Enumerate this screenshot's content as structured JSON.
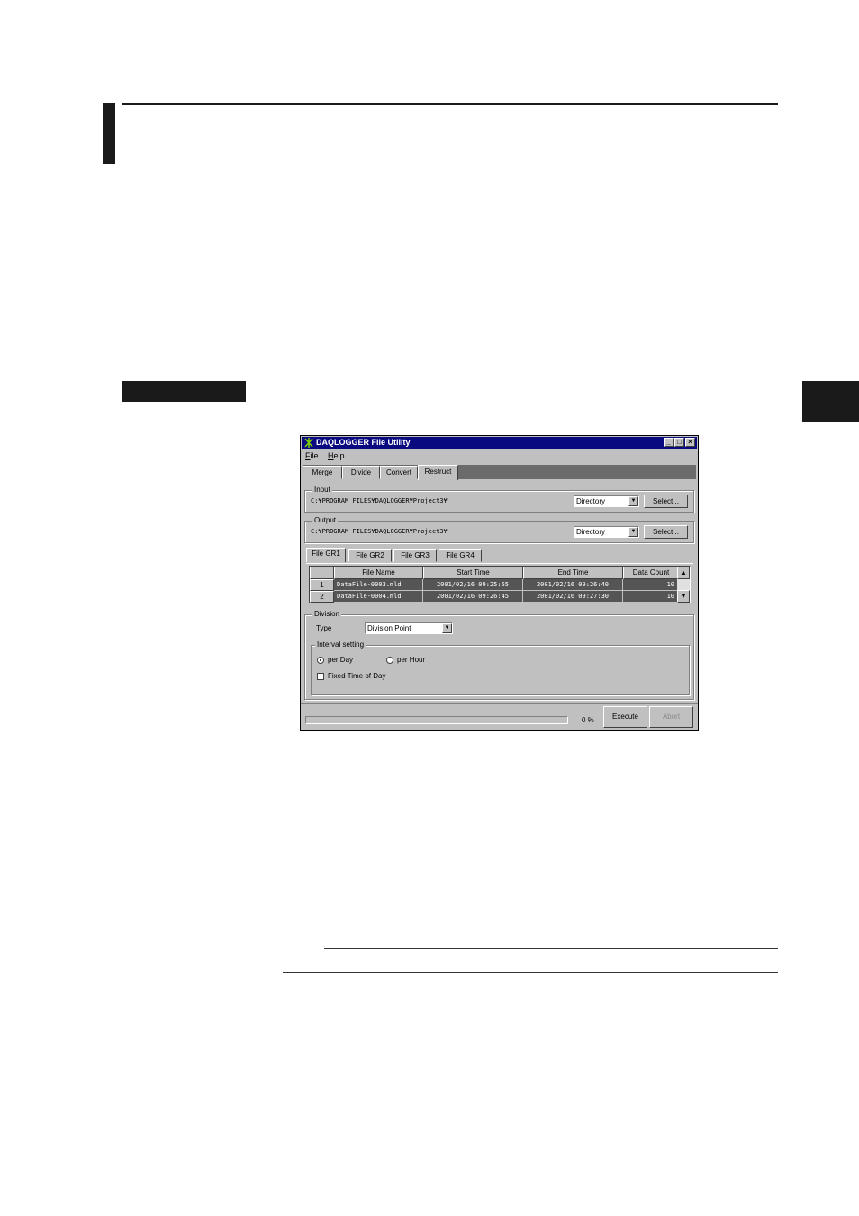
{
  "window": {
    "title": "DAQLOGGER File Utility",
    "controls": {
      "minimize": "_",
      "maximize": "□",
      "close": "×"
    }
  },
  "menu": {
    "file": {
      "accel": "F",
      "rest": "ile"
    },
    "help": {
      "accel": "H",
      "rest": "elp"
    }
  },
  "tabs": [
    "Merge",
    "Divide",
    "Convert",
    "Restruct"
  ],
  "active_tab": "Restruct",
  "input": {
    "label": "Input",
    "path": "C:¥PROGRAM FILES¥DAQLOGGER¥Project3¥",
    "type": "Directory",
    "select_label": "Select..."
  },
  "output": {
    "label": "Output",
    "path": "C:¥PROGRAM FILES¥DAQLOGGER¥Project3¥",
    "type": "Directory",
    "select_label": "Select..."
  },
  "file_tabs": [
    "File GR1",
    "File GR2",
    "File GR3",
    "File GR4"
  ],
  "table": {
    "columns": [
      "File Name",
      "Start Time",
      "End Time",
      "Data Count"
    ],
    "rows": [
      {
        "index": "1",
        "file": "DataFile-0003.mld",
        "start": "2001/02/16 09:25:55",
        "end": "2001/02/16 09:26:40",
        "count": "10"
      },
      {
        "index": "2",
        "file": "DataFile-0004.mld",
        "start": "2001/02/16 09:26:45",
        "end": "2001/02/16 09:27:30",
        "count": "10"
      }
    ],
    "scroll_up": "▲",
    "scroll_down": "▼"
  },
  "division": {
    "label": "Division",
    "type_label": "Type",
    "type_value": "Division Point",
    "interval_label": "Interval setting",
    "per_day": "per Day",
    "per_hour": "per Hour",
    "per_day_selected": true,
    "fixed_time": "Fixed Time of Day",
    "fixed_time_checked": false
  },
  "status": {
    "progress_percent": 0,
    "progress_text": "0 %",
    "execute_label": "Execute",
    "abort_label": "Abort"
  },
  "colors": {
    "titlebar": "#0a0a80",
    "window_face": "#c0c0c0",
    "table_row_bg": "#555555"
  }
}
